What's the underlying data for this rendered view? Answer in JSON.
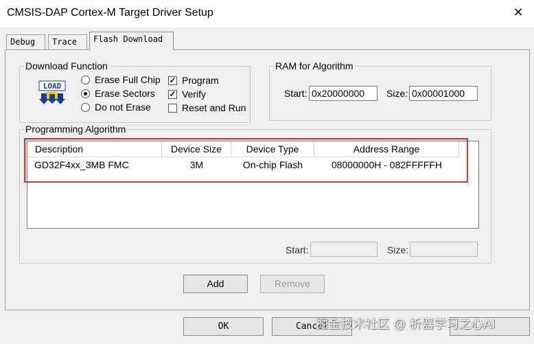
{
  "window": {
    "title": "CMSIS-DAP Cortex-M Target Driver Setup",
    "close_glyph": "✕"
  },
  "tabs": [
    {
      "label": "Debug"
    },
    {
      "label": "Trace"
    },
    {
      "label": "Flash Download",
      "active": true
    }
  ],
  "download_function": {
    "legend": "Download Function",
    "icon": "load-icon",
    "icon_text": "LOAD",
    "radios": [
      {
        "label": "Erase Full Chip",
        "selected": false
      },
      {
        "label": "Erase Sectors",
        "selected": true
      },
      {
        "label": "Do not Erase",
        "selected": false
      }
    ],
    "checks": [
      {
        "label": "Program",
        "checked": true,
        "glyph": "✓"
      },
      {
        "label": "Verify",
        "checked": true,
        "glyph": "✓"
      },
      {
        "label": "Reset and Run",
        "checked": false,
        "glyph": ""
      }
    ]
  },
  "ram": {
    "legend": "RAM for Algorithm",
    "start_label": "Start:",
    "start_value": "0x20000000",
    "size_label": "Size:",
    "size_value": "0x00001000"
  },
  "algorithm": {
    "legend": "Programming Algorithm",
    "columns": [
      "Description",
      "Device Size",
      "Device Type",
      "Address Range"
    ],
    "rows": [
      {
        "description": "GD32F4xx_3MB FMC",
        "size": "3M",
        "type": "On-chip Flash",
        "range": "08000000H - 082FFFFFH"
      }
    ],
    "start_label": "Start:",
    "start_value": "",
    "size_label": "Size:",
    "size_value": ""
  },
  "buttons": {
    "add": "Add",
    "remove": "Remove",
    "ok": "OK",
    "cancel": "Cancel"
  },
  "watermark": "掘金技术社区 @ 析器学习之心AI",
  "colors": {
    "highlight": "#e03030",
    "dialog_bg": "#f0f0f0"
  }
}
